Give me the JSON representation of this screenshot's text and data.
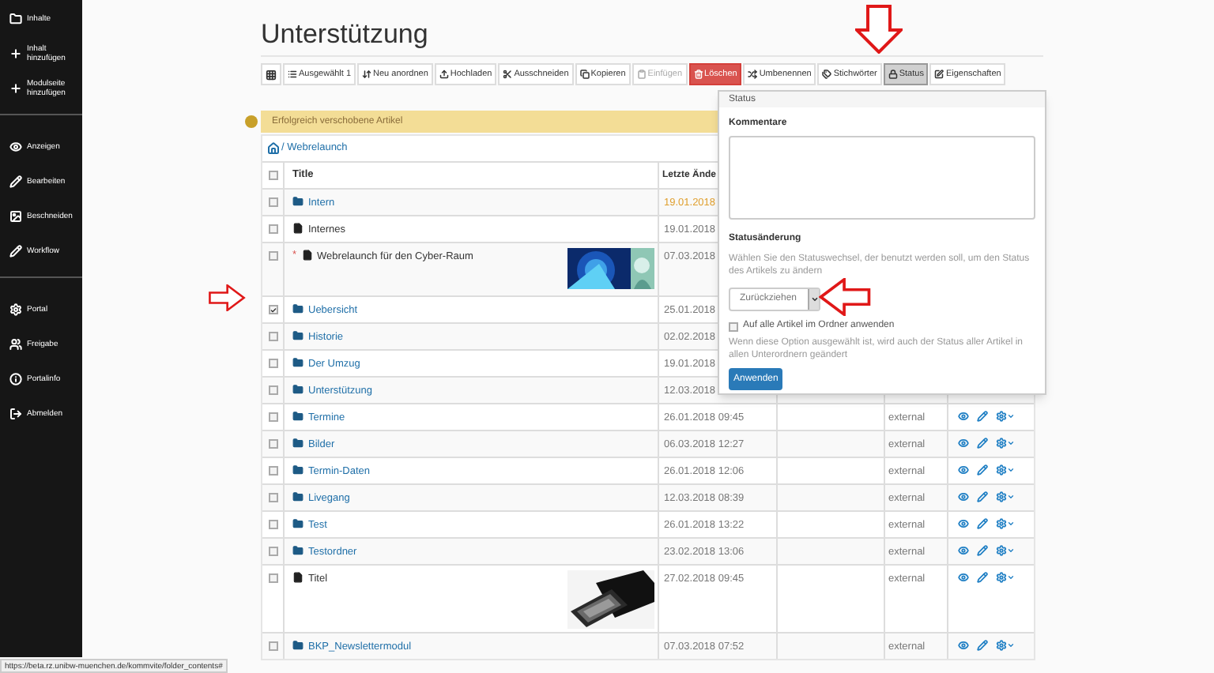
{
  "sidebar": {
    "sections": [
      {
        "items": [
          {
            "label": "Inhalte"
          },
          {
            "label": "Inhalt hinzufügen"
          },
          {
            "label": "Modulseite hinzufügen"
          }
        ]
      },
      {
        "items": [
          {
            "label": "Anzeigen"
          },
          {
            "label": "Bearbeiten"
          },
          {
            "label": "Beschneiden"
          },
          {
            "label": "Workflow"
          }
        ]
      },
      {
        "items": [
          {
            "label": "Portal"
          },
          {
            "label": "Freigabe"
          },
          {
            "label": "Portalinfo"
          },
          {
            "label": "Abmelden"
          }
        ]
      }
    ]
  },
  "page_title": "Unterstützung",
  "toolbar": [
    {
      "label": "Ausgewählt 1",
      "kind": "normal",
      "selected": false
    },
    {
      "label": "Neu anordnen",
      "kind": "normal",
      "selected": false
    },
    {
      "label": "Hochladen",
      "kind": "normal",
      "selected": false
    },
    {
      "label": "Ausschneiden",
      "kind": "normal",
      "selected": false
    },
    {
      "label": "Kopieren",
      "kind": "normal",
      "selected": false
    },
    {
      "label": "Einfügen",
      "kind": "disabled",
      "selected": false
    },
    {
      "label": "Löschen",
      "kind": "danger",
      "selected": false
    },
    {
      "label": "Umbenennen",
      "kind": "normal",
      "selected": false
    },
    {
      "label": "Stichwörter",
      "kind": "normal",
      "selected": false
    },
    {
      "label": "Status",
      "kind": "normal",
      "selected": true
    },
    {
      "label": "Eigenschaften",
      "kind": "normal",
      "selected": false
    }
  ],
  "alert": "Erfolgreich verschobene Artikel",
  "breadcrumb": "/ Webrelaunch",
  "table": {
    "select_all_checked": false,
    "columns": [
      "Title",
      "Letzte Ände"
    ],
    "rows": [
      {
        "title": "Intern",
        "kind": "folder",
        "date": "19.01.2018",
        "highlighted": true,
        "checked": false
      },
      {
        "title": "Internes",
        "kind": "document",
        "date": "19.01.2018",
        "highlighted": false,
        "checked": false
      },
      {
        "title": "Webrelaunch für den Cyber-Raum",
        "kind": "document",
        "marker": "*",
        "date": "07.03.2018",
        "highlighted": false,
        "checked": false
      },
      {
        "title": "Uebersicht",
        "kind": "folder",
        "date": "25.01.2018",
        "highlighted": false,
        "checked": true
      },
      {
        "title": "Historie",
        "kind": "folder",
        "date": "02.02.2018",
        "highlighted": false,
        "checked": false
      },
      {
        "title": "Der Umzug",
        "kind": "folder",
        "date": "19.01.2018",
        "highlighted": false,
        "checked": false
      },
      {
        "title": "Unterstützung",
        "kind": "folder",
        "date": "12.03.2018",
        "highlighted": false,
        "checked": false
      },
      {
        "title": "Termine",
        "kind": "folder",
        "date": "26.01.2018 09:45",
        "status": "external",
        "highlighted": false,
        "checked": false
      },
      {
        "title": "Bilder",
        "kind": "folder",
        "date": "06.03.2018 12:27",
        "status": "external",
        "highlighted": false,
        "checked": false
      },
      {
        "title": "Termin-Daten",
        "kind": "folder",
        "date": "26.01.2018 12:06",
        "status": "external",
        "highlighted": false,
        "checked": false
      },
      {
        "title": "Livegang",
        "kind": "folder",
        "date": "12.03.2018 08:39",
        "status": "external",
        "highlighted": false,
        "checked": false
      },
      {
        "title": "Test",
        "kind": "folder",
        "date": "26.01.2018 13:22",
        "status": "external",
        "highlighted": false,
        "checked": false
      },
      {
        "title": "Testordner",
        "kind": "folder",
        "date": "23.02.2018 13:06",
        "status": "external",
        "highlighted": false,
        "checked": false
      },
      {
        "title": "Titel",
        "kind": "document",
        "date": "27.02.2018 09:45",
        "status": "external",
        "highlighted": false,
        "checked": false
      },
      {
        "title": "BKP_Newslettermodul",
        "kind": "folder",
        "date": "07.03.2018 07:52",
        "status": "external",
        "highlighted": false,
        "checked": false
      }
    ]
  },
  "popup": {
    "title": "Status",
    "comments_label": "Kommentare",
    "change_label": "Statusänderung",
    "change_help": "Wählen Sie den Statuswechsel, der benutzt werden soll, um den Status des Artikels zu ändern",
    "select_value": "Zurückziehen",
    "apply_all": {
      "label": "Auf alle Artikel im Ordner anwenden",
      "checked": false
    },
    "apply_help": "Wenn diese Option ausgewählt ist, wird auch der Status aller Artikel in allen Unterordnern geändert",
    "button": "Anwenden"
  },
  "status_bar": "https://beta.rz.unibw-muenchen.de/kommvite/folder_contents#"
}
